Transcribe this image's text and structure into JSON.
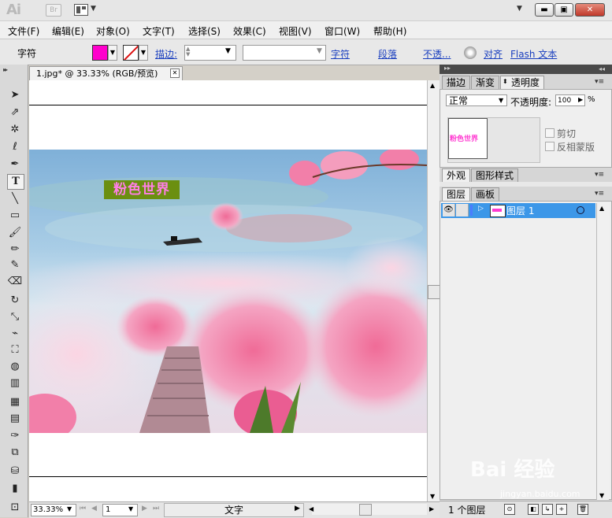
{
  "app": {
    "logo": "Ai",
    "bridge_label": "Br",
    "colors": {
      "fill": "#ff00cc",
      "layer_highlight": "#3c97e8",
      "link": "#1a3fbf"
    }
  },
  "window_controls": {
    "minimize": "▬",
    "restore": "▣",
    "close": "✕"
  },
  "menu": [
    "文件(F)",
    "编辑(E)",
    "对象(O)",
    "文字(T)",
    "选择(S)",
    "效果(C)",
    "视图(V)",
    "窗口(W)",
    "帮助(H)"
  ],
  "control_bar": {
    "label": "字符",
    "stroke_label": "描边:",
    "links": {
      "character": "字符",
      "paragraph": "段落",
      "opacity": "不透...",
      "align": "对齐",
      "flash_text": "Flash 文本"
    }
  },
  "document": {
    "tab_title": "1.jpg* @ 33.33% (RGB/预览)",
    "art_text": "粉色世界"
  },
  "status": {
    "zoom": "33.33%",
    "page": "1",
    "tool": "文字"
  },
  "panels": {
    "top_tabs": [
      "描边",
      "渐变",
      "透明度"
    ],
    "transparency": {
      "blend_mode": "正常",
      "opacity_label": "不透明度:",
      "opacity_value": "100",
      "opacity_unit": "%",
      "clip_label": "剪切",
      "invert_mask_label": "反相蒙版",
      "thumb_text": "粉色世界"
    },
    "mid_tabs": [
      "外观",
      "图形样式"
    ],
    "layer_tabs": [
      "图层",
      "画板"
    ],
    "layer_name": "图层 1",
    "layers_count": "1 个图层"
  },
  "watermark": {
    "main": "Bai 经验",
    "sub": "jingyan.baidu.com"
  }
}
